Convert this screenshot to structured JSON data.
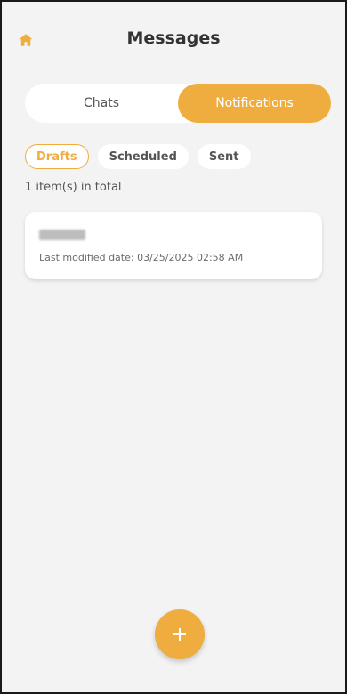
{
  "header": {
    "title": "Messages",
    "home_icon": "home-icon"
  },
  "tabs": {
    "chats_label": "Chats",
    "notifications_label": "Notifications",
    "selected": "Notifications"
  },
  "filters": {
    "items": [
      "Drafts",
      "Scheduled",
      "Sent"
    ],
    "selected": "Drafts"
  },
  "summary": {
    "total_text": "1 item(s) in total"
  },
  "drafts": [
    {
      "title": "",
      "modified_text": "Last modified date: 03/25/2025 02:58 AM"
    }
  ],
  "fab": {
    "icon": "plus-icon"
  },
  "colors": {
    "accent": "#efad3f",
    "background": "#f3f3f3",
    "surface": "#ffffff",
    "text": "#333333"
  }
}
